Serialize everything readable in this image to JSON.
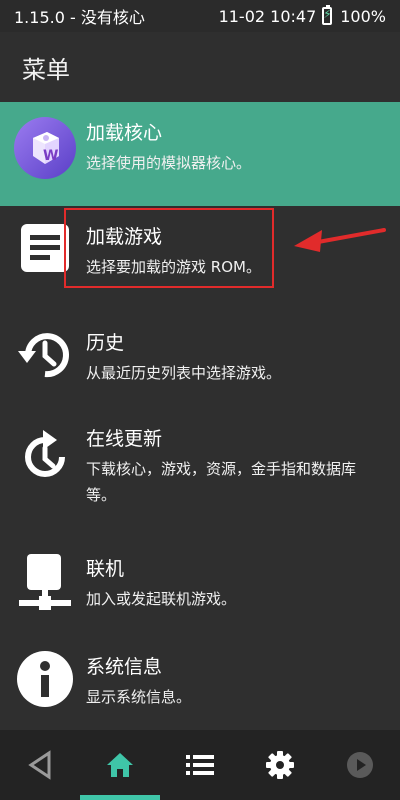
{
  "status_bar": {
    "left_text": "1.15.0 - 没有核心",
    "datetime": "11-02 10:47",
    "battery": "100%"
  },
  "header": {
    "title": "菜单"
  },
  "menu": {
    "items": [
      {
        "title": "加载核心",
        "desc": "选择使用的模拟器核心。",
        "icon": "core-app-icon",
        "selected": true
      },
      {
        "title": "加载游戏",
        "desc": "选择要加载的游戏 ROM。",
        "icon": "document-icon",
        "selected": false
      },
      {
        "title": "历史",
        "desc": "从最近历史列表中选择游戏。",
        "icon": "history-icon",
        "selected": false
      },
      {
        "title": "在线更新",
        "desc": "下载核心，游戏，资源，金手指和数据库等。",
        "icon": "update-clock-icon",
        "selected": false
      },
      {
        "title": "联机",
        "desc": "加入或发起联机游戏。",
        "icon": "network-icon",
        "selected": false
      },
      {
        "title": "系统信息",
        "desc": "显示系统信息。",
        "icon": "info-icon",
        "selected": false
      }
    ]
  },
  "bottom_nav": {
    "items": [
      "back-icon",
      "home-icon",
      "list-icon",
      "settings-icon",
      "play-icon"
    ],
    "active": "home-icon",
    "accent": "#3fc5a8"
  },
  "colors": {
    "selected_bg": "#46a98c",
    "highlight": "#e12b2b",
    "background": "#2f2f2f"
  }
}
